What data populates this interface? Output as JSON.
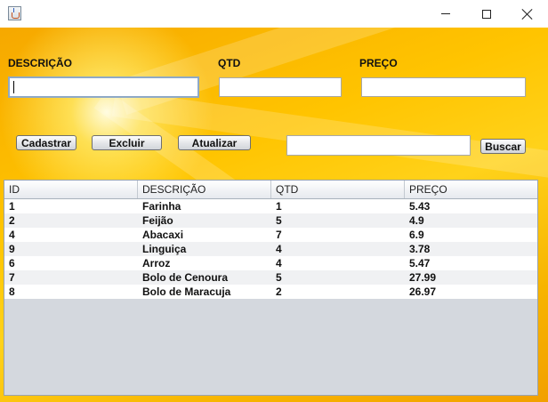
{
  "window": {
    "icons": {
      "app": "java-cup-icon",
      "minimize": "minimize-icon",
      "maximize": "maximize-icon",
      "close": "close-icon"
    }
  },
  "form": {
    "descricao": {
      "label": "DESCRIÇÃO",
      "value": ""
    },
    "qtd": {
      "label": "QTD",
      "value": ""
    },
    "preco": {
      "label": "PREÇO",
      "value": ""
    }
  },
  "actions": {
    "cadastrar": "Cadastrar",
    "excluir": "Excluir",
    "atualizar": "Atualizar"
  },
  "search": {
    "value": "",
    "button": "Buscar"
  },
  "table": {
    "columns": [
      "ID",
      "DESCRIÇÃO",
      "QTD",
      "PREÇO"
    ],
    "rows": [
      [
        "1",
        "Farinha",
        "1",
        "5.43"
      ],
      [
        "2",
        "Feijão",
        "5",
        "4.9"
      ],
      [
        "4",
        "Abacaxi",
        "7",
        "6.9"
      ],
      [
        "9",
        "Linguiça",
        "4",
        "3.78"
      ],
      [
        "6",
        "Arroz",
        "4",
        "5.47"
      ],
      [
        "7",
        "Bolo de Cenoura",
        "5",
        "27.99"
      ],
      [
        "8",
        "Bolo de Maracuja",
        "2",
        "26.97"
      ]
    ]
  },
  "colors": {
    "background_accent": "#ffc400",
    "table_empty_area": "#d4d8de"
  }
}
